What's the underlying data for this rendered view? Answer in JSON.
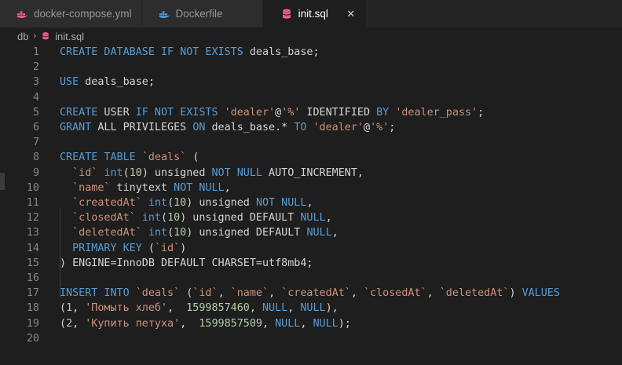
{
  "tabs": [
    {
      "label": "docker-compose.yml",
      "icon": "docker-icon",
      "active": false
    },
    {
      "label": "Dockerfile",
      "icon": "docker-icon",
      "active": false
    },
    {
      "label": "init.sql",
      "icon": "database-icon",
      "active": true
    }
  ],
  "close_glyph": "✕",
  "breadcrumb": {
    "folder": "db",
    "separator": "›",
    "file": "init.sql"
  },
  "colors": {
    "keyword": "#569cd6",
    "string": "#ce9178",
    "number": "#b5cea8",
    "text": "#d4d4d4",
    "docker": "#4a9bd6",
    "sql_icon": "#e95b8c"
  },
  "lines": [
    {
      "n": "1",
      "tokens": [
        {
          "t": "kw",
          "v": "CREATE DATABASE IF NOT EXISTS"
        },
        {
          "t": "p",
          "v": " deals_base;"
        }
      ]
    },
    {
      "n": "2",
      "tokens": []
    },
    {
      "n": "3",
      "tokens": [
        {
          "t": "kw",
          "v": "USE"
        },
        {
          "t": "p",
          "v": " deals_base;"
        }
      ]
    },
    {
      "n": "4",
      "tokens": []
    },
    {
      "n": "5",
      "tokens": [
        {
          "t": "kw",
          "v": "CREATE"
        },
        {
          "t": "p",
          "v": " USER "
        },
        {
          "t": "kw",
          "v": "IF NOT EXISTS"
        },
        {
          "t": "p",
          "v": " "
        },
        {
          "t": "str",
          "v": "'dealer'"
        },
        {
          "t": "p",
          "v": "@"
        },
        {
          "t": "str",
          "v": "'%'"
        },
        {
          "t": "p",
          "v": " IDENTIFIED "
        },
        {
          "t": "kw",
          "v": "BY"
        },
        {
          "t": "p",
          "v": " "
        },
        {
          "t": "str",
          "v": "'dealer_pass'"
        },
        {
          "t": "p",
          "v": ";"
        }
      ]
    },
    {
      "n": "6",
      "tokens": [
        {
          "t": "kw",
          "v": "GRANT"
        },
        {
          "t": "p",
          "v": " ALL PRIVILEGES "
        },
        {
          "t": "kw",
          "v": "ON"
        },
        {
          "t": "p",
          "v": " deals_base.* "
        },
        {
          "t": "kw",
          "v": "TO"
        },
        {
          "t": "p",
          "v": " "
        },
        {
          "t": "str",
          "v": "'dealer'"
        },
        {
          "t": "p",
          "v": "@"
        },
        {
          "t": "str",
          "v": "'%'"
        },
        {
          "t": "p",
          "v": ";"
        }
      ]
    },
    {
      "n": "7",
      "tokens": []
    },
    {
      "n": "8",
      "tokens": [
        {
          "t": "kw",
          "v": "CREATE TABLE"
        },
        {
          "t": "p",
          "v": " "
        },
        {
          "t": "str",
          "v": "`deals`"
        },
        {
          "t": "p",
          "v": " ("
        }
      ]
    },
    {
      "n": "9",
      "tokens": [
        {
          "t": "p",
          "v": "  "
        },
        {
          "t": "str",
          "v": "`id`"
        },
        {
          "t": "p",
          "v": " "
        },
        {
          "t": "kw",
          "v": "int"
        },
        {
          "t": "p",
          "v": "("
        },
        {
          "t": "num",
          "v": "10"
        },
        {
          "t": "p",
          "v": ") unsigned "
        },
        {
          "t": "kw",
          "v": "NOT NULL"
        },
        {
          "t": "p",
          "v": " AUTO_INCREMENT,"
        }
      ]
    },
    {
      "n": "10",
      "tokens": [
        {
          "t": "p",
          "v": "  "
        },
        {
          "t": "str",
          "v": "`name`"
        },
        {
          "t": "p",
          "v": " tinytext "
        },
        {
          "t": "kw",
          "v": "NOT NULL"
        },
        {
          "t": "p",
          "v": ","
        }
      ]
    },
    {
      "n": "11",
      "tokens": [
        {
          "t": "p",
          "v": "  "
        },
        {
          "t": "str",
          "v": "`createdAt`"
        },
        {
          "t": "p",
          "v": " "
        },
        {
          "t": "kw",
          "v": "int"
        },
        {
          "t": "p",
          "v": "("
        },
        {
          "t": "num",
          "v": "10"
        },
        {
          "t": "p",
          "v": ") unsigned "
        },
        {
          "t": "kw",
          "v": "NOT NULL"
        },
        {
          "t": "p",
          "v": ","
        }
      ]
    },
    {
      "n": "12",
      "tokens": [
        {
          "t": "p",
          "v": "  "
        },
        {
          "t": "str",
          "v": "`closedAt`"
        },
        {
          "t": "p",
          "v": " "
        },
        {
          "t": "kw",
          "v": "int"
        },
        {
          "t": "p",
          "v": "("
        },
        {
          "t": "num",
          "v": "10"
        },
        {
          "t": "p",
          "v": ") unsigned DEFAULT "
        },
        {
          "t": "kw",
          "v": "NULL"
        },
        {
          "t": "p",
          "v": ","
        }
      ]
    },
    {
      "n": "13",
      "tokens": [
        {
          "t": "p",
          "v": "  "
        },
        {
          "t": "str",
          "v": "`deletedAt`"
        },
        {
          "t": "p",
          "v": " "
        },
        {
          "t": "kw",
          "v": "int"
        },
        {
          "t": "p",
          "v": "("
        },
        {
          "t": "num",
          "v": "10"
        },
        {
          "t": "p",
          "v": ") unsigned DEFAULT "
        },
        {
          "t": "kw",
          "v": "NULL"
        },
        {
          "t": "p",
          "v": ","
        }
      ]
    },
    {
      "n": "14",
      "tokens": [
        {
          "t": "p",
          "v": "  "
        },
        {
          "t": "kw",
          "v": "PRIMARY KEY"
        },
        {
          "t": "p",
          "v": " ("
        },
        {
          "t": "str",
          "v": "`id`"
        },
        {
          "t": "p",
          "v": ")"
        }
      ]
    },
    {
      "n": "15",
      "tokens": [
        {
          "t": "p",
          "v": ") ENGINE=InnoDB DEFAULT CHARSET=utf8mb4;"
        }
      ]
    },
    {
      "n": "16",
      "tokens": []
    },
    {
      "n": "17",
      "tokens": [
        {
          "t": "kw",
          "v": "INSERT INTO"
        },
        {
          "t": "p",
          "v": " "
        },
        {
          "t": "str",
          "v": "`deals`"
        },
        {
          "t": "p",
          "v": " ("
        },
        {
          "t": "str",
          "v": "`id`"
        },
        {
          "t": "p",
          "v": ", "
        },
        {
          "t": "str",
          "v": "`name`"
        },
        {
          "t": "p",
          "v": ", "
        },
        {
          "t": "str",
          "v": "`createdAt`"
        },
        {
          "t": "p",
          "v": ", "
        },
        {
          "t": "str",
          "v": "`closedAt`"
        },
        {
          "t": "p",
          "v": ", "
        },
        {
          "t": "str",
          "v": "`deletedAt`"
        },
        {
          "t": "p",
          "v": ") "
        },
        {
          "t": "kw",
          "v": "VALUES"
        }
      ]
    },
    {
      "n": "18",
      "tokens": [
        {
          "t": "p",
          "v": "("
        },
        {
          "t": "num",
          "v": "1"
        },
        {
          "t": "p",
          "v": ", "
        },
        {
          "t": "str",
          "v": "'Помыть хлеб'"
        },
        {
          "t": "p",
          "v": ",  "
        },
        {
          "t": "num",
          "v": "1599857460"
        },
        {
          "t": "p",
          "v": ", "
        },
        {
          "t": "kw",
          "v": "NULL"
        },
        {
          "t": "p",
          "v": ", "
        },
        {
          "t": "kw",
          "v": "NULL"
        },
        {
          "t": "p",
          "v": "),"
        }
      ]
    },
    {
      "n": "19",
      "tokens": [
        {
          "t": "p",
          "v": "("
        },
        {
          "t": "num",
          "v": "2"
        },
        {
          "t": "p",
          "v": ", "
        },
        {
          "t": "str",
          "v": "'Купить петуха'"
        },
        {
          "t": "p",
          "v": ",  "
        },
        {
          "t": "num",
          "v": "1599857509"
        },
        {
          "t": "p",
          "v": ", "
        },
        {
          "t": "kw",
          "v": "NULL"
        },
        {
          "t": "p",
          "v": ", "
        },
        {
          "t": "kw",
          "v": "NULL"
        },
        {
          "t": "p",
          "v": ");"
        }
      ]
    },
    {
      "n": "20",
      "tokens": []
    }
  ]
}
